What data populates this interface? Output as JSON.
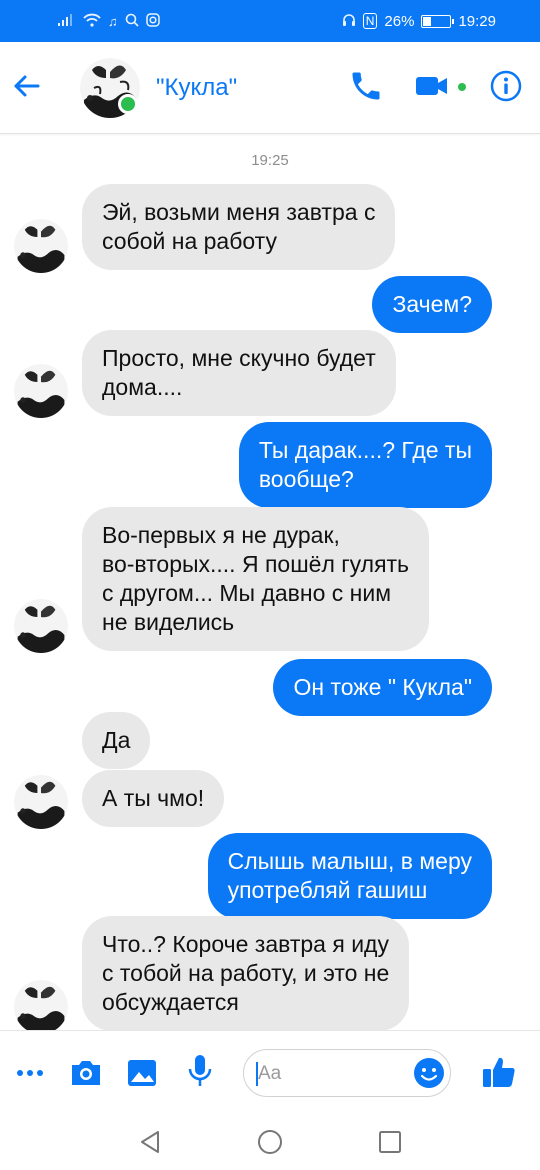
{
  "status_bar": {
    "battery": "26%",
    "time": "19:29",
    "n_indicator": "N",
    "battery_level": 0.26
  },
  "header": {
    "contact_name": "\"Кукла\"",
    "avatar_icon": "avatar-butterfly-icon",
    "online": true
  },
  "conversation": {
    "timestamp": "19:25",
    "messages": [
      {
        "side": "received",
        "text": "Эй, возьми меня завтра с\nсобой на работу"
      },
      {
        "side": "sent",
        "text": "Зачем?"
      },
      {
        "side": "received",
        "text": "Просто, мне скучно будет\nдома...."
      },
      {
        "side": "sent",
        "text": "Ты дарак....? Где ты\nвообще?"
      },
      {
        "side": "received",
        "text": "Во-первых я не дурак,\nво-вторых.... Я пошёл гулять\nс другом... Мы давно с ним\nне виделись"
      },
      {
        "side": "sent",
        "text": "Он тоже \" Кукла\""
      },
      {
        "side": "received",
        "text": "Да"
      },
      {
        "side": "received",
        "text": "А ты чмо!"
      },
      {
        "side": "sent",
        "text": "Слышь малыш, в меру\nупотребляй гашиш"
      },
      {
        "side": "received",
        "text": "Что..? Короче завтра я иду\nс тобой на работу, и это не\nобсуждается"
      }
    ]
  },
  "composer": {
    "placeholder": "Aa"
  },
  "colors": {
    "accent": "#0b78f5",
    "received_bubble": "#e8e8e8",
    "online": "#2bbd4e"
  }
}
